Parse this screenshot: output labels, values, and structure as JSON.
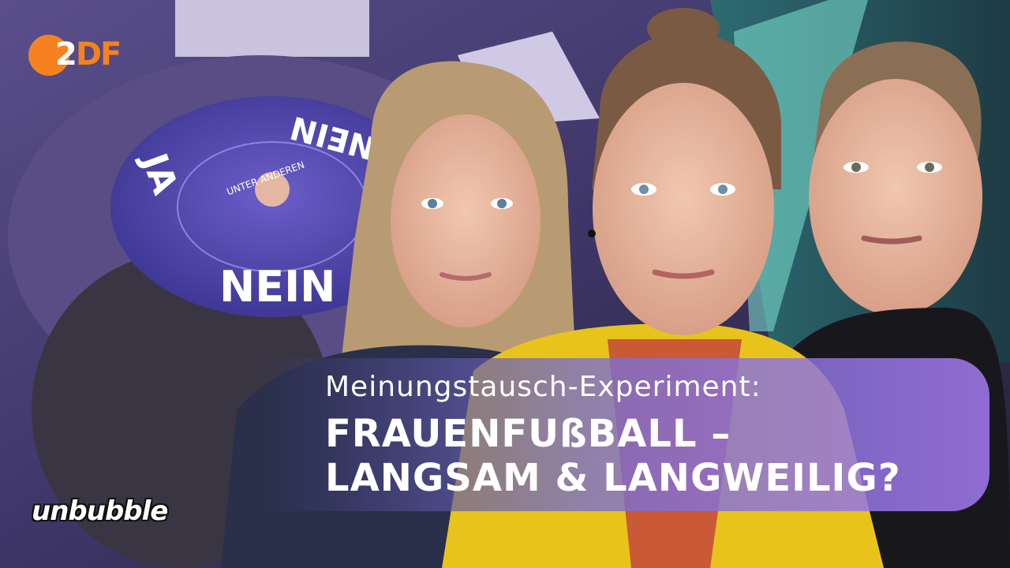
{
  "logo": {
    "zdf_part1": "2",
    "zdf_part2": "DF"
  },
  "set": {
    "disc_ja": "JA",
    "disc_nein_top": "NEIN",
    "disc_nein_bottom": "NEIN",
    "disc_center": "UNTER ANDEREN"
  },
  "title": {
    "subtitle": "Meinungstausch-Experiment:",
    "line1": "FRAUENFUßBALL –",
    "line2": "LANGSAM & LANGWEILIG?"
  },
  "brand": {
    "name": "unbubble"
  },
  "colors": {
    "zdf_orange": "#f5821f",
    "banner_purple": "#a078eb",
    "jacket_yellow": "#e8c31c"
  }
}
